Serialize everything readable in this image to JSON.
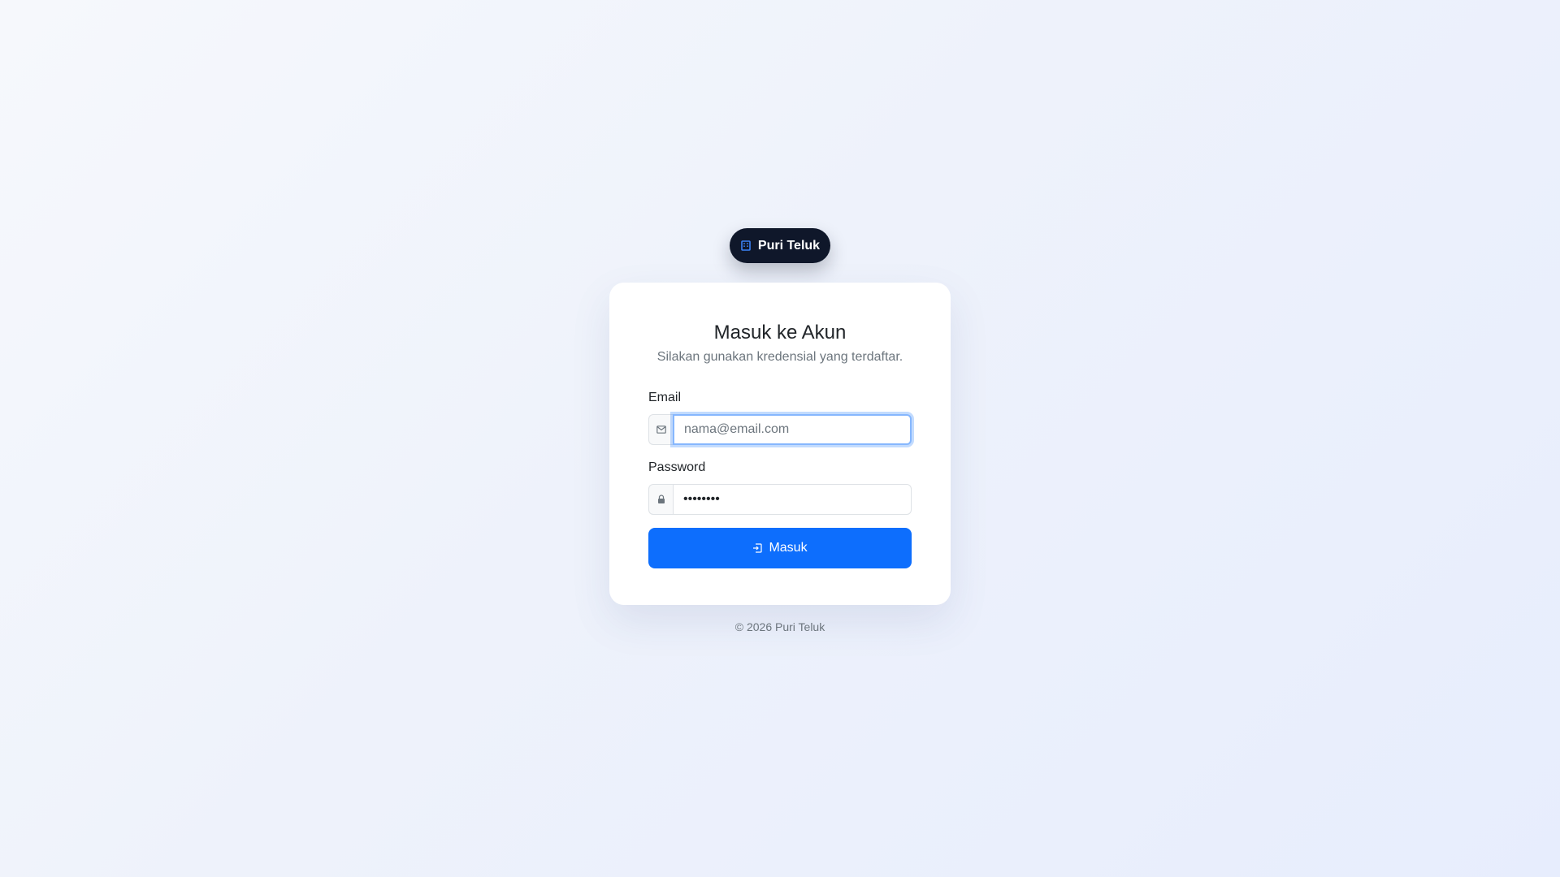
{
  "brand": {
    "name": "Puri Teluk",
    "icon": "building-icon",
    "icon_color": "#3b82f6",
    "background_color": "#0f172a"
  },
  "login": {
    "title": "Masuk ke Akun",
    "subtitle": "Silakan gunakan kredensial yang terdaftar.",
    "email": {
      "label": "Email",
      "placeholder": "nama@email.com",
      "value": "",
      "icon": "envelope-icon"
    },
    "password": {
      "label": "Password",
      "value": "••••••••",
      "icon": "lock-icon"
    },
    "submit": {
      "label": "Masuk",
      "icon": "sign-in-icon",
      "color": "#0d6efd"
    }
  },
  "footer": {
    "text": "© 2026 Puri Teluk"
  }
}
